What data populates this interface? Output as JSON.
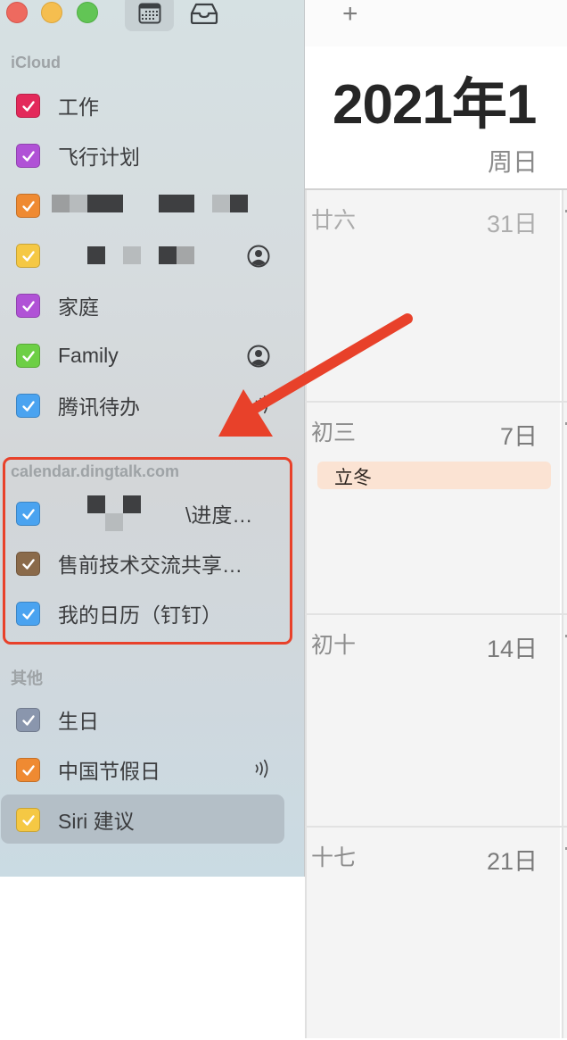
{
  "window": {
    "traffic_lights": [
      "close",
      "minimize",
      "zoom"
    ],
    "toolbar": {
      "calendar_view_icon": "calendar-icon",
      "inbox_icon": "inbox-icon",
      "add_label": "+"
    }
  },
  "sidebar": {
    "sections": [
      {
        "title": "iCloud",
        "items": [
          {
            "label": "工作",
            "color": "#e3295a",
            "checked": true
          },
          {
            "label": "飞行计划",
            "color": "#b052d6",
            "checked": true
          },
          {
            "label": "",
            "redacted": true,
            "color": "#ef8a32",
            "checked": true
          },
          {
            "label": "",
            "redacted": true,
            "color": "#f5c844",
            "checked": true,
            "trailing_icon": "shared-person-icon"
          },
          {
            "label": "家庭",
            "color": "#b052d6",
            "checked": true
          },
          {
            "label": "Family",
            "color": "#6dcf45",
            "checked": true,
            "trailing_icon": "shared-person-icon"
          },
          {
            "label": "腾讯待办",
            "color": "#4aa3f0",
            "checked": true,
            "trailing_icon": "subscribed-broadcast-icon"
          }
        ]
      },
      {
        "title": "calendar.dingtalk.com",
        "items": [
          {
            "label": "\\进度…",
            "redacted": true,
            "color": "#4aa3f0",
            "checked": true
          },
          {
            "label": "售前技术交流共享…",
            "color": "#8a6a4a",
            "checked": true
          },
          {
            "label": "我的日历（钉钉）",
            "color": "#4aa3f0",
            "checked": true
          }
        ]
      },
      {
        "title": "其他",
        "items": [
          {
            "label": "生日",
            "color": "#8a96ad",
            "checked": true
          },
          {
            "label": "中国节假日",
            "color": "#ef8a32",
            "checked": true,
            "trailing_icon": "subscribed-broadcast-icon"
          },
          {
            "label": "Siri 建议",
            "color": "#f5c844",
            "checked": true,
            "selected": true
          }
        ]
      }
    ]
  },
  "main": {
    "title": "2021年1",
    "weekday": "周日",
    "weeks": [
      {
        "lunar": "廿六",
        "day": "31日",
        "other_month": true,
        "events": []
      },
      {
        "lunar": "初三",
        "day": "7日",
        "events": [
          {
            "title": "立冬",
            "color": "#fbe3d3"
          }
        ]
      },
      {
        "lunar": "初十",
        "day": "14日",
        "events": []
      },
      {
        "lunar": "十七",
        "day": "21日",
        "events": []
      }
    ]
  },
  "annotation": {
    "color": "#e8412a",
    "target": "calendar.dingtalk.com"
  }
}
